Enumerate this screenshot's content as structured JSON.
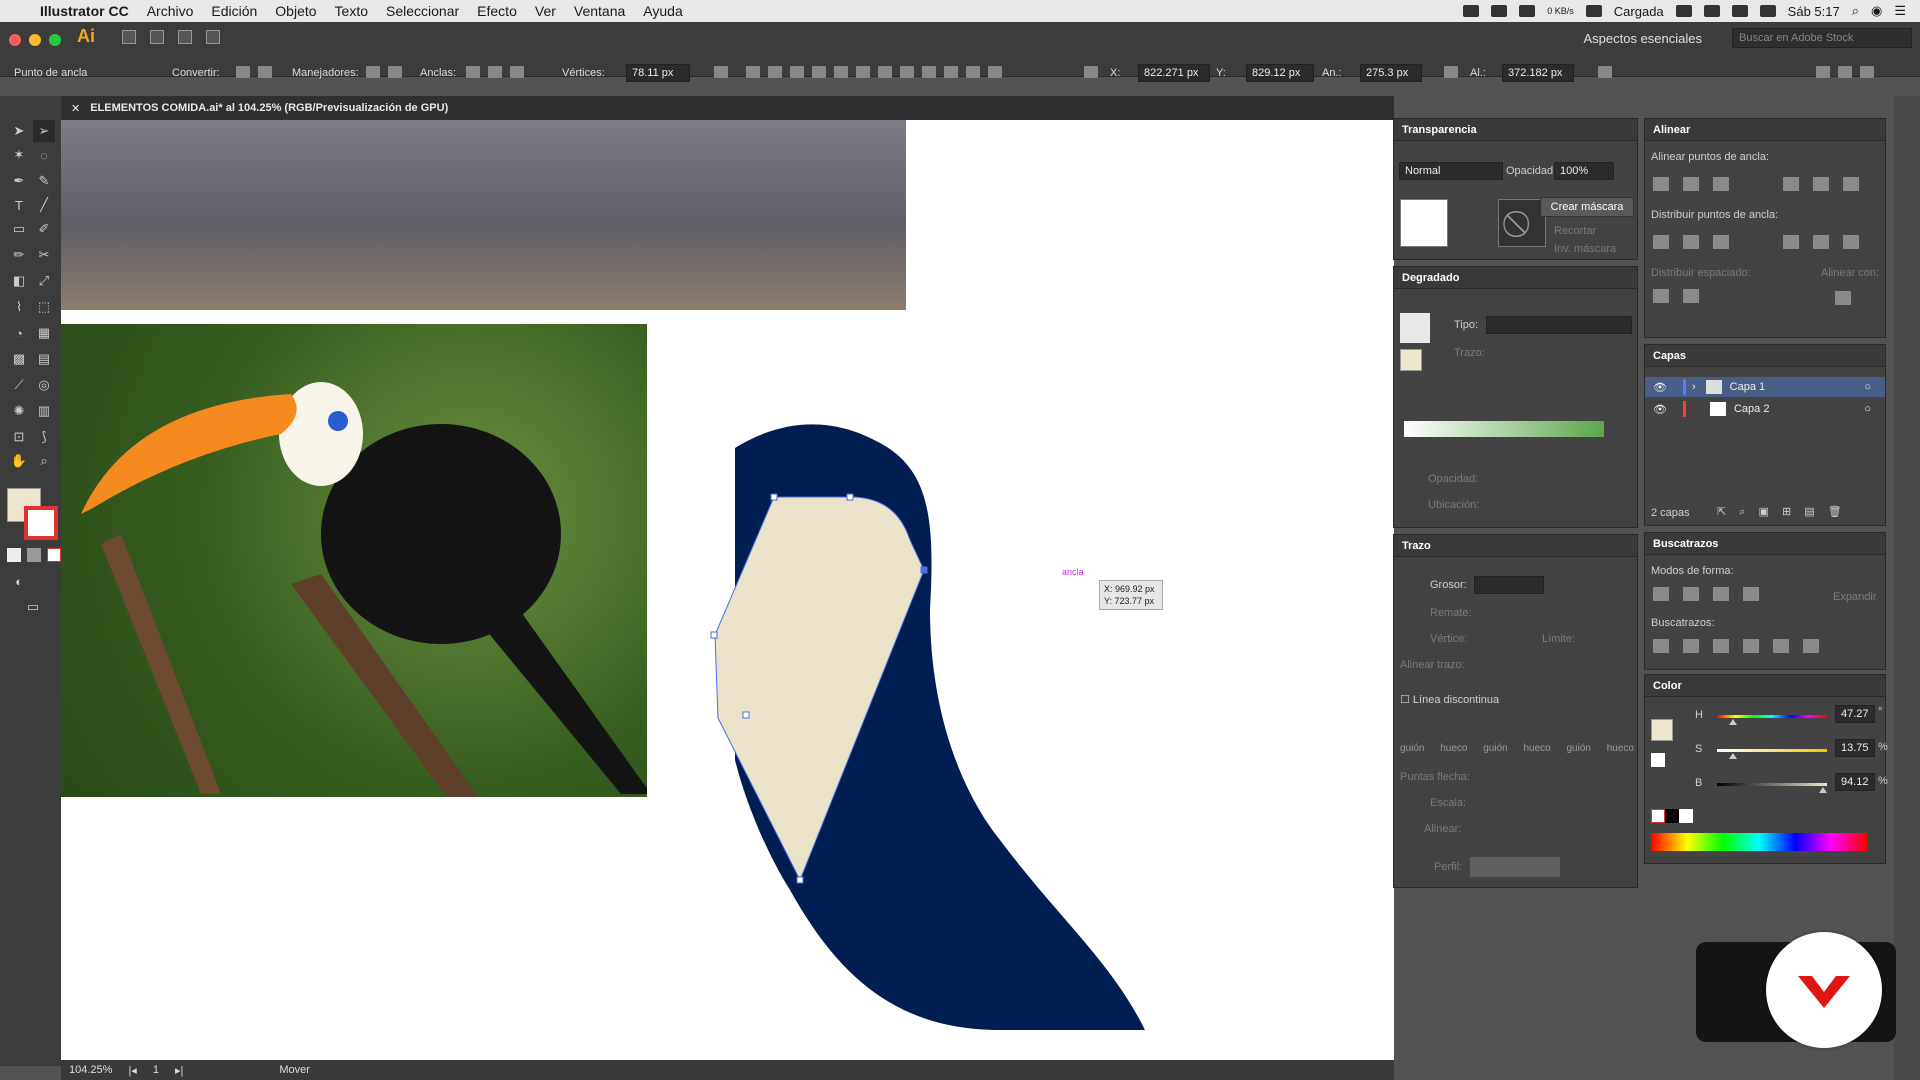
{
  "menubar": {
    "app_name": "Illustrator CC",
    "items": [
      "Archivo",
      "Edición",
      "Objeto",
      "Texto",
      "Seleccionar",
      "Efecto",
      "Ver",
      "Ventana",
      "Ayuda"
    ],
    "status_text": "Cargada",
    "net": "0 KB/s",
    "clock": "Sáb 5:17"
  },
  "control": {
    "workspace": "Aspectos esenciales",
    "search_placeholder": "Buscar en Adobe Stock",
    "anchor_label": "Punto de ancla",
    "convert_label": "Convertir:",
    "handles_label": "Manejadores:",
    "anchors_label": "Anclas:",
    "vertices_label": "Vértices:",
    "vertices_value": "78.11 px",
    "x_label": "X:",
    "x_value": "822.271 px",
    "y_label": "Y:",
    "y_value": "829.12 px",
    "w_label": "An.:",
    "w_value": "275.3 px",
    "h_label": "Al.:",
    "h_value": "372.182 px"
  },
  "document": {
    "tab_title": "ELEMENTOS COMIDA.ai* al 104.25% (RGB/Previsualización de GPU)",
    "zoom": "104.25%",
    "artboard": "1",
    "status": "Mover",
    "tooltip_x": "X: 969.92 px",
    "tooltip_y": "Y: 723.77 px",
    "anchor_hint": "ancla"
  },
  "transparency": {
    "title": "Transparencia",
    "blend": "Normal",
    "opacity_label": "Opacidad:",
    "opacity": "100%",
    "mask_btn": "Crear máscara",
    "clip": "Recortar",
    "invert": "Inv. máscara"
  },
  "gradient": {
    "title": "Degradado",
    "type_label": "Tipo:",
    "stroke_label": "Trazo:",
    "opacity_label": "Opacidad:",
    "location_label": "Ubicación:"
  },
  "stroke": {
    "title": "Trazo",
    "weight_label": "Grosor:",
    "cap_label": "Remate:",
    "corner_label": "Vértice:",
    "limit_label": "Límite:",
    "align_label": "Alinear trazo:",
    "dashed_label": "Línea discontinua",
    "dash_labels": [
      "guión",
      "hueco",
      "guión",
      "hueco",
      "guión",
      "hueco"
    ],
    "arrows_label": "Puntas flecha:",
    "scale_label": "Escala:",
    "align2_label": "Alinear:",
    "profile_label": "Perfil:"
  },
  "align": {
    "title": "Alinear",
    "align_points": "Alinear puntos de ancla:",
    "distribute_points": "Distribuir puntos de ancla:",
    "distribute_spacing": "Distribuir espaciado:",
    "align_to": "Alinear con:"
  },
  "layers": {
    "title": "Capas",
    "rows": [
      {
        "name": "Capa 1",
        "color": "#4f7fff"
      },
      {
        "name": "Capa 2",
        "color": "#ff3b3b"
      }
    ],
    "count": "2 capas"
  },
  "pathfinder": {
    "title": "Buscatrazos",
    "shape_modes": "Modos de forma:",
    "expand": "Expandir",
    "pathfinders": "Buscatrazos:"
  },
  "color": {
    "title": "Color",
    "h_label": "H",
    "h_value": "47.27",
    "s_label": "S",
    "s_value": "13.75",
    "b_label": "B",
    "b_value": "94.12",
    "percent": "%",
    "degree": "°"
  },
  "colors": {
    "navy": "#001e52",
    "cream": "#ebe3c9",
    "path_blue": "#4a6fe0",
    "fill_swatch": "#efe6d0"
  }
}
